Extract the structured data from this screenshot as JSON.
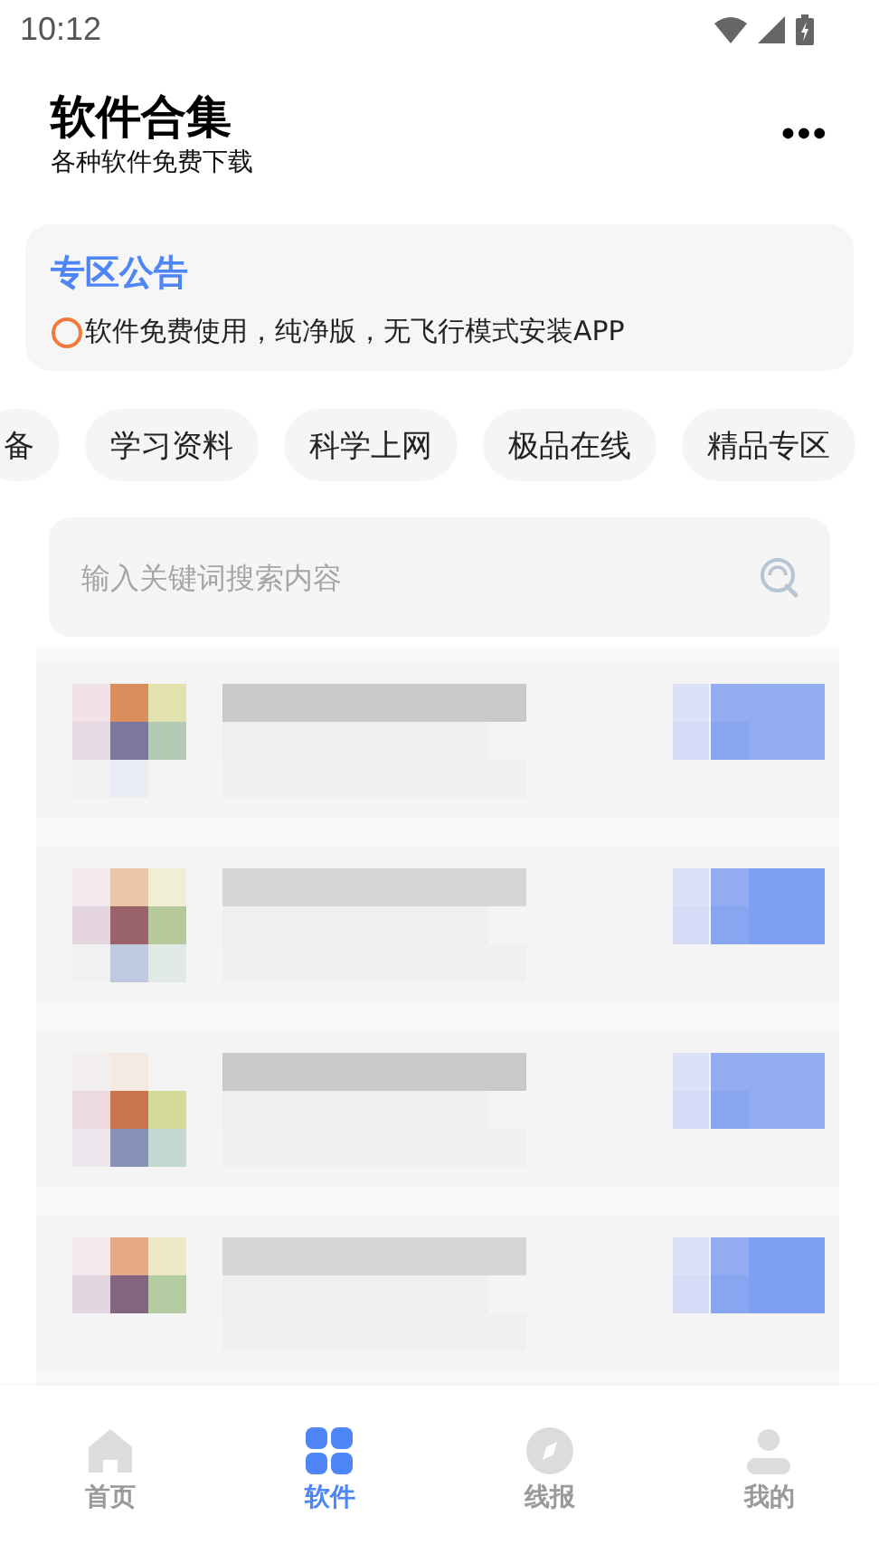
{
  "status_bar": {
    "time": "10:12"
  },
  "header": {
    "title": "软件合集",
    "subtitle": "各种软件免费下载",
    "menu": "•••"
  },
  "notice": {
    "title": "专区公告",
    "text": "软件免费使用，纯净版，无飞行模式安装APP"
  },
  "categories": [
    {
      "label": "备",
      "selected": false
    },
    {
      "label": "学习资料",
      "selected": false
    },
    {
      "label": "科学上网",
      "selected": false
    },
    {
      "label": "极品在线",
      "selected": false
    },
    {
      "label": "精品专区",
      "selected": false
    }
  ],
  "search": {
    "placeholder": "输入关键词搜索内容"
  },
  "tab_bar": [
    {
      "label": "首页",
      "kind": "home",
      "selected": false
    },
    {
      "label": "软件",
      "kind": "grid",
      "selected": true
    },
    {
      "label": "线报",
      "kind": "compass",
      "selected": false
    },
    {
      "label": "我的",
      "kind": "person",
      "selected": false
    }
  ]
}
